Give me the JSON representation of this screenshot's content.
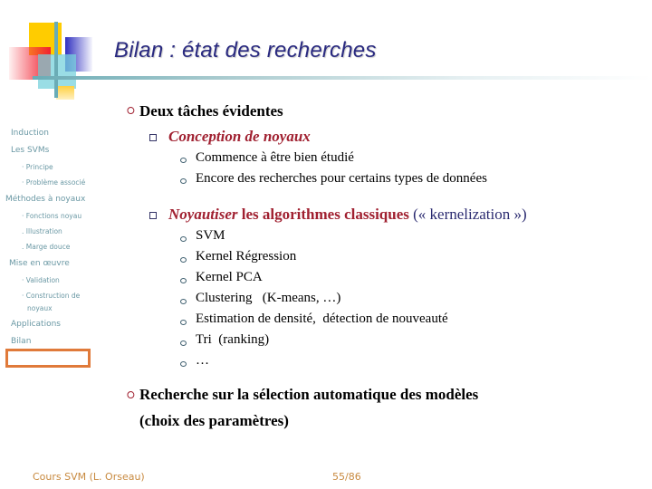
{
  "slide": {
    "title": "Bilan : état des recherches",
    "accent_colors": {
      "title": "#2a2a80",
      "highlight": "#a02030",
      "sidebar": "#6a98a4",
      "footer": "#c88a40",
      "current_box": "#e07a3a"
    }
  },
  "sidebar": {
    "items": [
      {
        "label": "Induction",
        "level": 1
      },
      {
        "label": "Les SVMs",
        "level": 1
      },
      {
        "label": "· Principe",
        "level": 2
      },
      {
        "label": "· Problème associé",
        "level": 2
      },
      {
        "label": "Méthodes à noyaux",
        "level": 1
      },
      {
        "label": "· Fonctions noyau",
        "level": 2
      },
      {
        "label": ". Illustration",
        "level": 2
      },
      {
        "label": ". Marge douce",
        "level": 2
      },
      {
        "label": "Mise en œuvre",
        "level": 1
      },
      {
        "label": "· Validation",
        "level": 2
      },
      {
        "label": "· Construction de",
        "level": 2
      },
      {
        "label": "noyaux",
        "level": 2
      },
      {
        "label": "Applications",
        "level": 1
      },
      {
        "label": "Bilan",
        "level": 1
      }
    ]
  },
  "content": {
    "point1": {
      "text": "Deux tâches évidentes",
      "sub1": {
        "text": "Conception de noyaux",
        "items": [
          "Commence à être bien étudié",
          "Encore des recherches pour certains types de données"
        ]
      },
      "sub2": {
        "emph": "Noyautiser",
        "text": " les algorithmes classiques ",
        "paren": "(« kernelization »)",
        "items": [
          "SVM",
          "Kernel Régression",
          "Kernel PCA",
          "Clustering   (K-means, …)",
          "Estimation de densité,  détection de nouveauté",
          "Tri  (ranking)",
          "…"
        ]
      }
    },
    "point2": {
      "line1": "Recherche sur la sélection automatique des modèles",
      "line2": "(choix des paramètres)"
    }
  },
  "footer": {
    "course": "Cours SVM  (L. Orseau)",
    "page": "55/86"
  }
}
